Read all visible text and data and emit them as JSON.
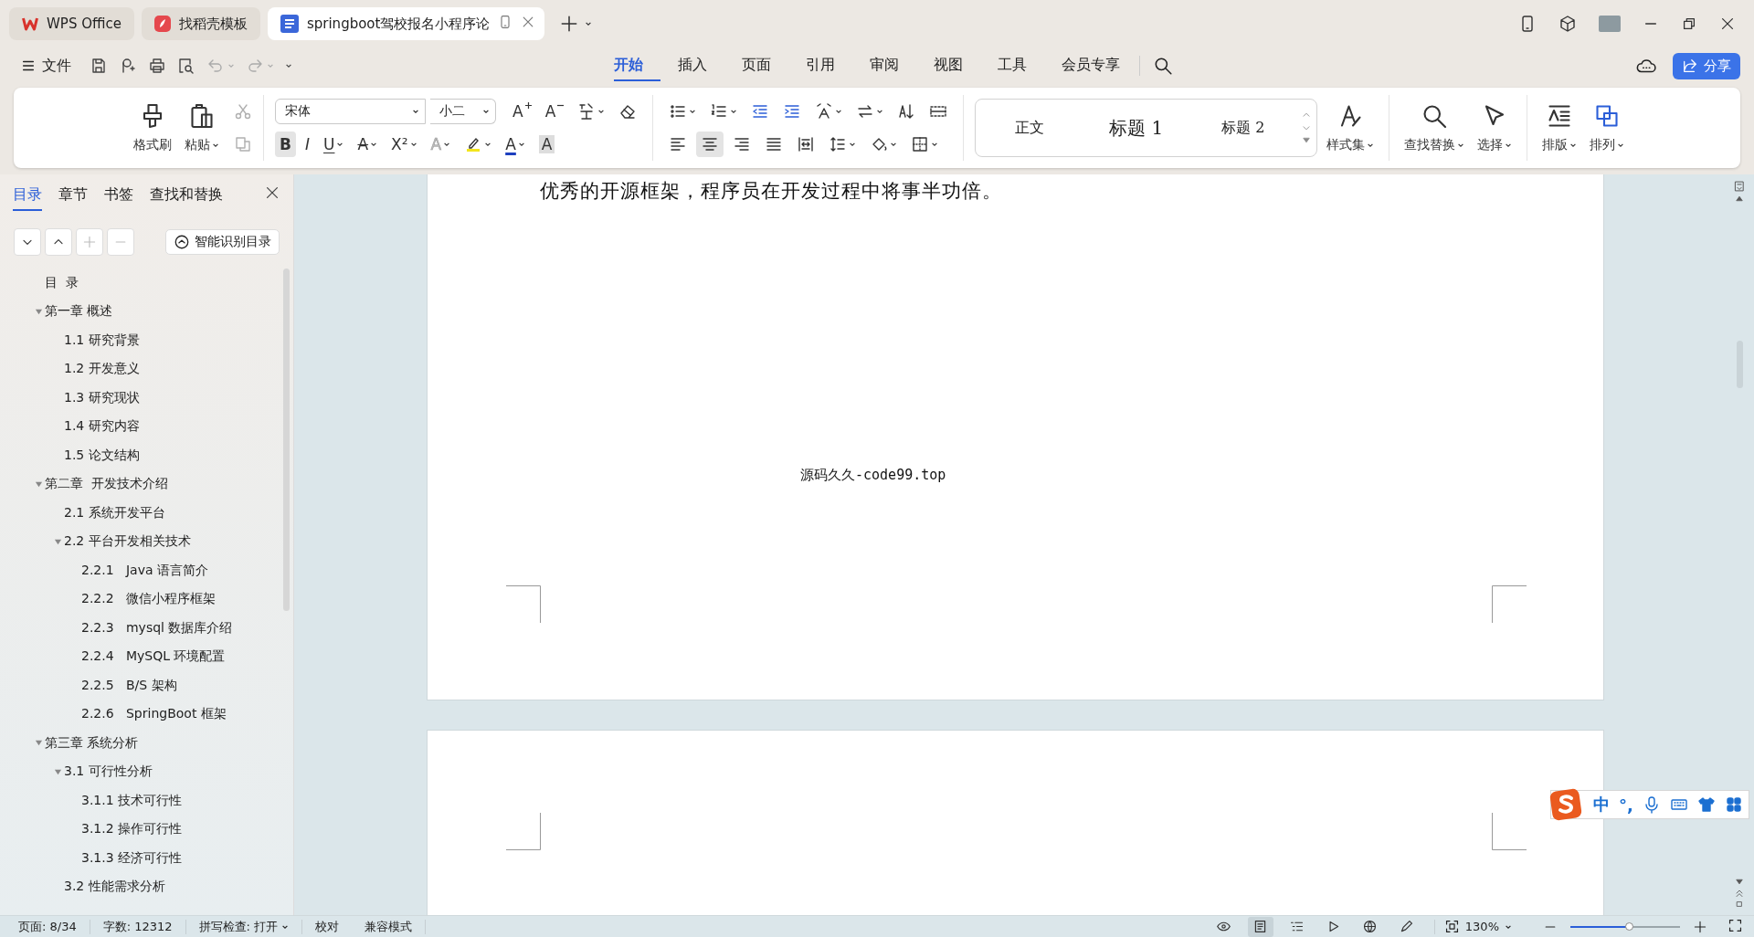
{
  "title_bar": {
    "tabs": [
      {
        "kind": "app",
        "label": "WPS Office",
        "selected": false
      },
      {
        "kind": "template",
        "label": "找稻壳模板",
        "selected": false
      },
      {
        "kind": "document",
        "label": "springboot驾校报名小程序论",
        "selected": true
      }
    ]
  },
  "menu_bar": {
    "file": "文件",
    "tabs": [
      {
        "label": "开始",
        "selected": true
      },
      {
        "label": "插入",
        "selected": false
      },
      {
        "label": "页面",
        "selected": false
      },
      {
        "label": "引用",
        "selected": false
      },
      {
        "label": "审阅",
        "selected": false
      },
      {
        "label": "视图",
        "selected": false
      },
      {
        "label": "工具",
        "selected": false
      },
      {
        "label": "会员专享",
        "selected": false
      }
    ],
    "share": "分享"
  },
  "ribbon": {
    "format_painter": "格式刷",
    "paste": "粘贴",
    "font_name": "宋体",
    "font_size": "小二",
    "glyph_buttons": [
      {
        "kind": "grow",
        "label": "A"
      },
      {
        "kind": "shrink",
        "label": "A"
      },
      {
        "kind": "strike",
        "label": "A"
      },
      {
        "kind": "superscript",
        "label": "X²"
      },
      {
        "kind": "effect",
        "label": "A"
      },
      {
        "kind": "color",
        "label": "A"
      },
      {
        "kind": "shade",
        "label": "A"
      }
    ],
    "text_buttons": [
      {
        "kind": "bold",
        "label": "B",
        "selected": true
      },
      {
        "kind": "italic",
        "label": "I",
        "selected": false
      },
      {
        "kind": "underline",
        "label": "U",
        "selected": false
      }
    ],
    "alignments": [
      {
        "kind": "left",
        "selected": false
      },
      {
        "kind": "center",
        "selected": true
      },
      {
        "kind": "right",
        "selected": false
      },
      {
        "kind": "justify",
        "selected": false
      },
      {
        "kind": "distribute",
        "selected": false
      }
    ],
    "styles": [
      "正文",
      "标题 1",
      "标题 2"
    ],
    "style_set": "样式集",
    "find_replace": "查找替换",
    "select": "选择",
    "layout": "排版",
    "arrange": "排列"
  },
  "sidebar": {
    "tabs": [
      {
        "label": "目录",
        "selected": true
      },
      {
        "label": "章节",
        "selected": false
      },
      {
        "label": "书签",
        "selected": false
      },
      {
        "label": "查找和替换",
        "selected": false
      }
    ],
    "smart_button": "智能识别目录",
    "toc": [
      {
        "label": "目  录"
      },
      {
        "label": "第一章 概述",
        "expanded": true,
        "children": [
          {
            "label": "1.1 研究背景"
          },
          {
            "label": "1.2 开发意义"
          },
          {
            "label": "1.3 研究现状"
          },
          {
            "label": "1.4 研究内容"
          },
          {
            "label": "1.5 论文结构"
          }
        ]
      },
      {
        "label": "第二章  开发技术介绍",
        "expanded": true,
        "children": [
          {
            "label": "2.1 系统开发平台"
          },
          {
            "label": "2.2 平台开发相关技术",
            "expanded": true,
            "children": [
              {
                "label": "2.2.1   Java 语言简介"
              },
              {
                "label": "2.2.2   微信小程序框架"
              },
              {
                "label": "2.2.3   mysql 数据库介绍"
              },
              {
                "label": "2.2.4   MySQL 环境配置"
              },
              {
                "label": "2.2.5   B/S 架构"
              },
              {
                "label": "2.2.6   SpringBoot 框架"
              }
            ]
          }
        ]
      },
      {
        "label": "第三章 系统分析",
        "expanded": true,
        "children": [
          {
            "label": "3.1 可行性分析",
            "expanded": true,
            "children": [
              {
                "label": "3.1.1 技术可行性"
              },
              {
                "label": "3.1.2 操作可行性"
              },
              {
                "label": "3.1.3 经济可行性"
              }
            ]
          },
          {
            "label": "3.2 性能需求分析"
          }
        ]
      }
    ]
  },
  "document": {
    "top_text": "优秀的开源框架，程序员在开发过程中将事半功倍。",
    "center_text": "源码久久-code99.top"
  },
  "status_bar": {
    "items": [
      {
        "kind": "text",
        "label": "页面: 8/34"
      },
      {
        "kind": "text",
        "label": "字数: 12312"
      },
      {
        "kind": "dropdown",
        "label": "拼写检查: 打开"
      },
      {
        "kind": "text",
        "label": "校对"
      },
      {
        "kind": "text",
        "label": "兼容模式"
      }
    ],
    "view_modes": [
      {
        "kind": "eye",
        "selected": false
      },
      {
        "kind": "page",
        "selected": true
      },
      {
        "kind": "outline",
        "selected": false
      },
      {
        "kind": "play",
        "selected": false
      },
      {
        "kind": "web",
        "selected": false
      },
      {
        "kind": "pen",
        "selected": false
      }
    ],
    "zoom": "130%",
    "zoom_slider": {
      "level": 0.54
    }
  },
  "ime": {
    "mode": "中",
    "punctuation": "°,"
  }
}
